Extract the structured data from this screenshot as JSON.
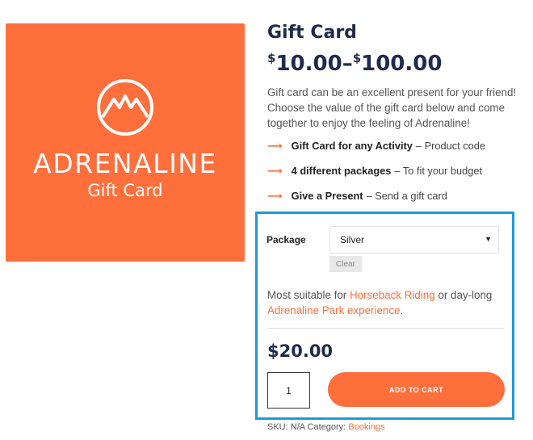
{
  "image": {
    "brand": "ADRENALINE",
    "subtitle": "Gift Card",
    "background": "#ff6f3c",
    "icon": "mountain-logo-icon"
  },
  "product": {
    "title": "Gift Card",
    "price_min_currency": "$",
    "price_min": "10.00",
    "price_sep": "–",
    "price_max_currency": "$",
    "price_max": "100.00",
    "description": "Gift card can be an excellent present for your friend! Choose the value of the gift card below and come together to enjoy the feeling of Adrenaline!"
  },
  "features": [
    {
      "bold": "Gift Card for any Activity",
      "rest": "– Product code"
    },
    {
      "bold": "4 different packages",
      "rest": "– To fit your budget"
    },
    {
      "bold": "Give a Present",
      "rest": "– Send a gift card"
    }
  ],
  "variation": {
    "label": "Package",
    "selected": "Silver",
    "clear_label": "Clear",
    "suit_prefix": "Most suitable for ",
    "link1": "Horseback Riding",
    "suit_middle": " or day-long ",
    "link2": "Adrenaline Park experience",
    "suit_suffix": ".",
    "price": "$20.00",
    "quantity": "1",
    "add_to_cart": "ADD TO CART",
    "highlight_color": "#1e9ad6"
  },
  "meta": {
    "sku_label": "SKU:",
    "sku": "N/A",
    "category_label": "Category:",
    "category": "Bookings"
  },
  "colors": {
    "accent": "#ff6f3c",
    "heading": "#1f2b4d"
  }
}
